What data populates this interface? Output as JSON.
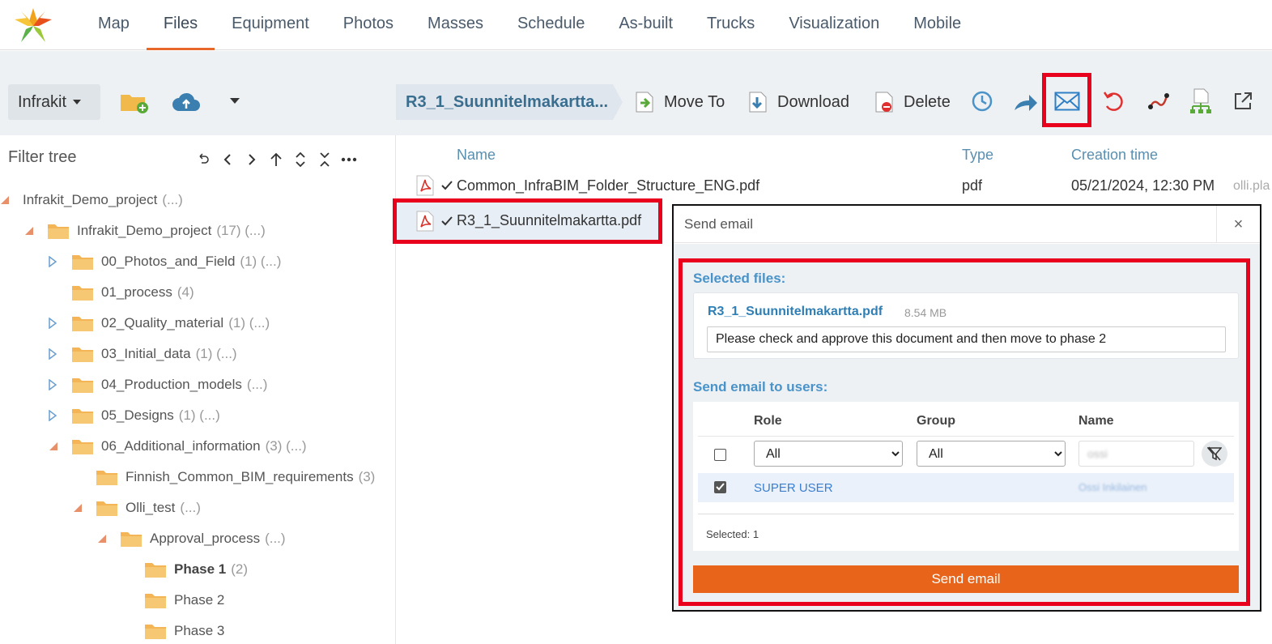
{
  "nav": {
    "tabs": [
      "Map",
      "Files",
      "Equipment",
      "Photos",
      "Masses",
      "Schedule",
      "As-built",
      "Trucks",
      "Visualization",
      "Mobile"
    ],
    "active": "Files"
  },
  "toolbar": {
    "project_label": "Infrakit",
    "breadcrumb": "R3_1_Suunnitelmakartta...",
    "move_to": "Move To",
    "download": "Download",
    "delete": "Delete"
  },
  "tree": {
    "filter_label": "Filter tree",
    "nodes": [
      {
        "label": "Infrakit_Demo_project",
        "count": "(...)"
      },
      {
        "label": "Infrakit_Demo_project",
        "count": "(17) (...)"
      },
      {
        "label": "00_Photos_and_Field",
        "count": "(1) (...)"
      },
      {
        "label": "01_process",
        "count": "(4)"
      },
      {
        "label": "02_Quality_material",
        "count": "(1) (...)"
      },
      {
        "label": "03_Initial_data",
        "count": "(1) (...)"
      },
      {
        "label": "04_Production_models",
        "count": "(...)"
      },
      {
        "label": "05_Designs",
        "count": "(1) (...)"
      },
      {
        "label": "06_Additional_information",
        "count": "(3) (...)"
      },
      {
        "label": "Finnish_Common_BIM_requirements",
        "count": "(3)"
      },
      {
        "label": "Olli_test",
        "count": "(...)"
      },
      {
        "label": "Approval_process",
        "count": "(...)"
      },
      {
        "label": "Phase 1",
        "count": "(2)"
      },
      {
        "label": "Phase 2",
        "count": ""
      },
      {
        "label": "Phase 3",
        "count": ""
      }
    ]
  },
  "files": {
    "headers": {
      "name": "Name",
      "type": "Type",
      "created": "Creation time"
    },
    "rows": [
      {
        "name": "Common_InfraBIM_Folder_Structure_ENG.pdf",
        "type": "pdf",
        "created": "05/21/2024, 12:30 PM",
        "author": "olli.pla"
      },
      {
        "name": "R3_1_Suunnitelmakartta.pdf"
      }
    ]
  },
  "modal": {
    "title": "Send email",
    "close": "×",
    "selected_files_label": "Selected files:",
    "file_name": "R3_1_Suunnitelmakartta.pdf",
    "file_size": "8.54 MB",
    "message": "Please check and approve this document and then move to phase 2",
    "send_to_label": "Send email to users:",
    "columns": {
      "role": "Role",
      "group": "Group",
      "name": "Name"
    },
    "role_filter": "All",
    "group_filter": "All",
    "name_filter": "ossi",
    "user": {
      "role": "SUPER USER",
      "name": "Ossi Inkilainen"
    },
    "selected_count": "Selected: 1",
    "send_button": "Send email"
  },
  "colors": {
    "accent": "#e8672a",
    "highlight": "#e8001c",
    "link": "#2f7fb5",
    "send": "#e8641a"
  }
}
